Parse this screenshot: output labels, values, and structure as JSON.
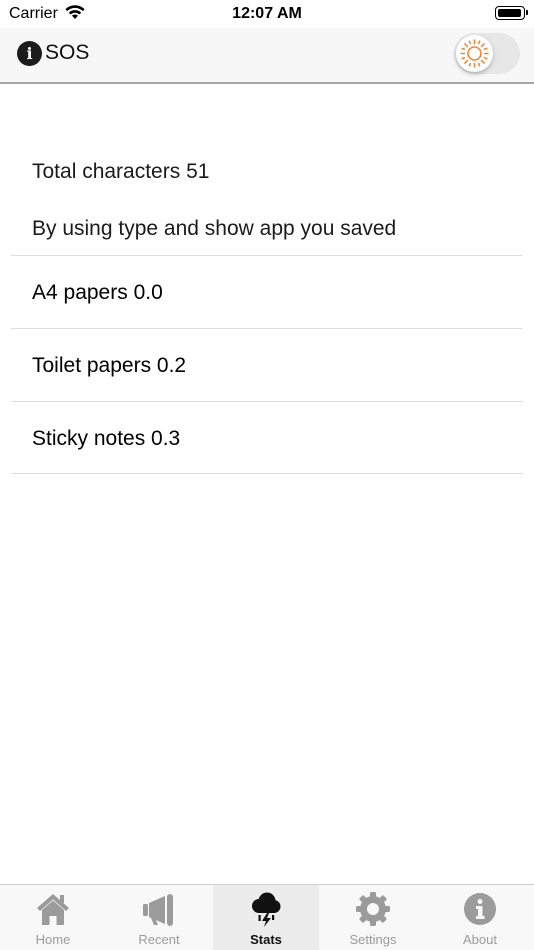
{
  "status_bar": {
    "carrier": "Carrier",
    "time": "12:07 AM"
  },
  "nav": {
    "title": "SOS",
    "info_icon": "info-circle-icon",
    "theme_toggle_icon": "sun-icon",
    "accent_color": "#f0883a"
  },
  "stats": {
    "total_characters": "Total characters 51",
    "saved_intro": "By using type and show app you saved",
    "rows": [
      {
        "label": "A4 papers 0.0"
      },
      {
        "label": "Toilet papers 0.2"
      },
      {
        "label": "Sticky notes 0.3"
      }
    ]
  },
  "tabs": [
    {
      "label": "Home",
      "icon": "house-icon",
      "active": false
    },
    {
      "label": "Recent",
      "icon": "megaphone-icon",
      "active": false
    },
    {
      "label": "Stats",
      "icon": "storm-cloud-icon",
      "active": true
    },
    {
      "label": "Settings",
      "icon": "gear-icon",
      "active": false
    },
    {
      "label": "About",
      "icon": "info-circle-icon",
      "active": false
    }
  ]
}
